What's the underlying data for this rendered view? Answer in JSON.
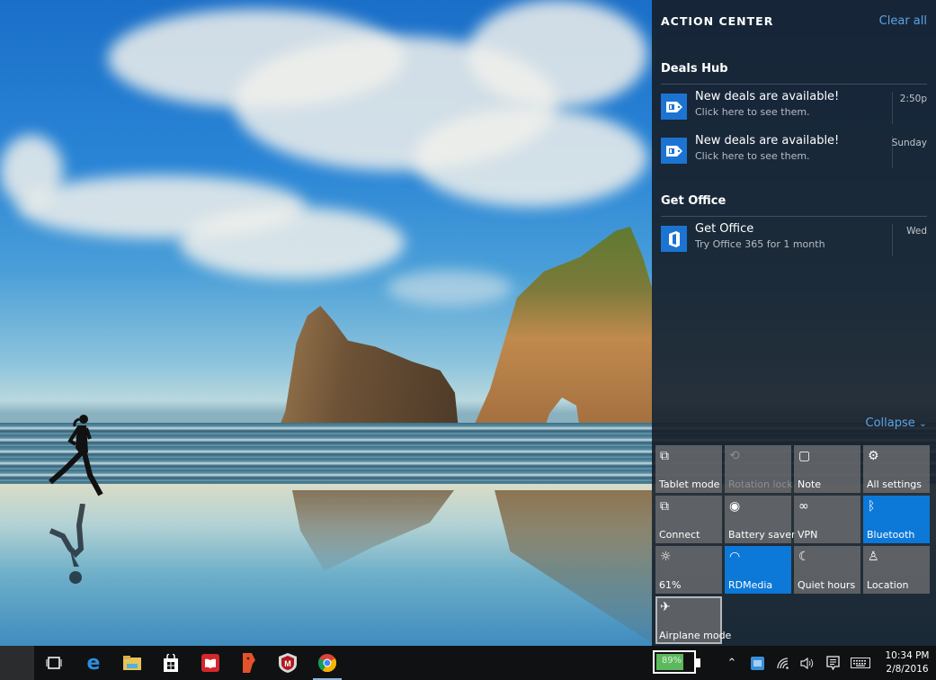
{
  "action_center": {
    "title": "ACTION CENTER",
    "clear_all": "Clear all",
    "collapse": "Collapse",
    "collapse_chevron": "⌄",
    "groups": [
      {
        "title": "Deals Hub",
        "notifications": [
          {
            "icon": "deals-tag-icon",
            "title": "New deals are available!",
            "body": "Click here to see them.",
            "time": "2:50p"
          },
          {
            "icon": "deals-tag-icon",
            "title": "New deals are available!",
            "body": "Click here to see them.",
            "time": "Sunday"
          }
        ]
      },
      {
        "title": "Get Office",
        "notifications": [
          {
            "icon": "office-icon",
            "title": "Get Office",
            "body": "Try Office 365 for 1 month",
            "time": "Wed"
          }
        ]
      }
    ],
    "quick_actions": [
      {
        "label": "Tablet mode",
        "icon": "tablet-mode-icon",
        "glyph": "⧉",
        "state": "off"
      },
      {
        "label": "Rotation lock",
        "icon": "rotation-lock-icon",
        "glyph": "⟲",
        "state": "disabled"
      },
      {
        "label": "Note",
        "icon": "note-icon",
        "glyph": "▢",
        "state": "off"
      },
      {
        "label": "All settings",
        "icon": "gear-icon",
        "glyph": "⚙",
        "state": "off"
      },
      {
        "label": "Connect",
        "icon": "connect-icon",
        "glyph": "⧉",
        "state": "off"
      },
      {
        "label": "Battery saver",
        "icon": "battery-saver-icon",
        "glyph": "◉",
        "state": "off"
      },
      {
        "label": "VPN",
        "icon": "vpn-icon",
        "glyph": "∞",
        "state": "off"
      },
      {
        "label": "Bluetooth",
        "icon": "bluetooth-icon",
        "glyph": "ᛒ",
        "state": "on"
      },
      {
        "label": "61%",
        "icon": "brightness-icon",
        "glyph": "☼",
        "state": "off"
      },
      {
        "label": "RDMedia",
        "icon": "wifi-icon",
        "glyph": "◠",
        "state": "on"
      },
      {
        "label": "Quiet hours",
        "icon": "moon-icon",
        "glyph": "☾",
        "state": "off"
      },
      {
        "label": "Location",
        "icon": "location-icon",
        "glyph": "♙",
        "state": "off"
      },
      {
        "label": "Airplane mode",
        "icon": "airplane-icon",
        "glyph": "✈",
        "state": "focused"
      }
    ]
  },
  "taskbar": {
    "apps": [
      {
        "name": "task-view",
        "glyph": "▭"
      },
      {
        "name": "edge",
        "glyph": "e"
      },
      {
        "name": "file-explorer",
        "glyph": "▬"
      },
      {
        "name": "store",
        "glyph": "▦"
      },
      {
        "name": "reader",
        "glyph": "▣"
      },
      {
        "name": "app-orange",
        "glyph": "◗"
      },
      {
        "name": "mcafee",
        "glyph": "M"
      },
      {
        "name": "chrome",
        "glyph": "◎"
      }
    ],
    "battery_percent": "89%",
    "battery_level": 0.89,
    "tray": {
      "show_hidden": "⌃",
      "network": "◠",
      "volume": "🔈",
      "notifications": "▤",
      "keyboard": "⌨"
    },
    "clock": {
      "time": "10:34 PM",
      "date": "2/8/2016"
    }
  },
  "colors": {
    "accent": "#0c78d8",
    "link": "#5aa5e6",
    "battery": "#5cb85c"
  }
}
